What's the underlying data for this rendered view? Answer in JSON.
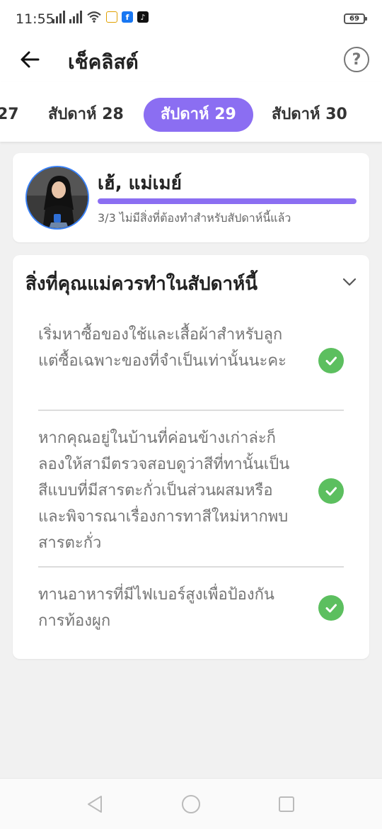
{
  "status_bar": {
    "time": "11:55",
    "battery": "69",
    "facebook_glyph": "f",
    "tiktok_glyph": "♪"
  },
  "header": {
    "title": "เช็คลิสต์",
    "help_glyph": "?"
  },
  "week_tabs": [
    {
      "label": "27",
      "active": false
    },
    {
      "label": "สัปดาห์ 28",
      "active": false
    },
    {
      "label": "สัปดาห์ 29",
      "active": true
    },
    {
      "label": "สัปดาห์ 30",
      "active": false
    }
  ],
  "profile": {
    "greeting": "เฮ้, แม่เมย์",
    "progress": {
      "done": 3,
      "total": 3
    },
    "status_text": "3/3 ไม่มีสิ่งที่ต้องทำสำหรับสัปดาห์นี้แล้ว"
  },
  "todo": {
    "title": "สิ่งที่คุณแม่ควรทำในสัปดาห์นี้",
    "items": [
      {
        "text": "เริ่มหาซื้อของใช้และเสื้อผ้าสำหรับลูก แต่ซื้อเฉพาะของที่จำเป็นเท่านั้นนะคะ",
        "done": true
      },
      {
        "text": "หากคุณอยู่ในบ้านที่ค่อนข้างเก่าล่ะก็ ลองให้สามีตรวจสอบดูว่าสีที่ทานั้นเป็นสีแบบที่มีสารตะกั่วเป็นส่วนผสมหรือ และพิจารณาเรื่องการทาสีใหม่หากพบสารตะกั่ว",
        "done": true
      },
      {
        "text": "ทานอาหารที่มีไฟเบอร์สูงเพื่อป้องกันการท้องผูก",
        "done": true
      }
    ]
  },
  "colors": {
    "accent": "#8b6ef2",
    "check_green": "#5cbf5f"
  },
  "icons": {
    "back": "arrow-left-icon",
    "help": "question-circle-icon",
    "collapse": "chevron-down-icon",
    "check": "check-circle-icon"
  }
}
